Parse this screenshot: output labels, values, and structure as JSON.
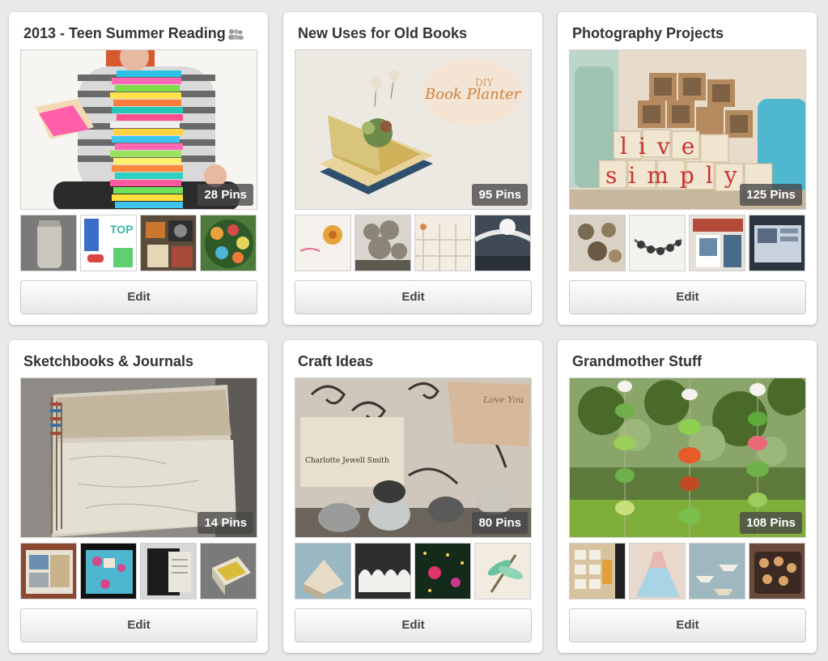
{
  "boards": [
    {
      "title": "2013 - Teen Summer Reading",
      "pin_count": "28 Pins",
      "edit_label": "Edit",
      "collaborators_icon": "group-icon",
      "cover_overlay_text": "",
      "thumbnails": [
        "mason-jar",
        "top-shoes-page",
        "camera-collage",
        "spools-and-beads"
      ]
    },
    {
      "title": "New Uses for Old Books",
      "pin_count": "95 Pins",
      "edit_label": "Edit",
      "cover_overlay_text": "",
      "cover_text_small": "DIY",
      "cover_text_large": "Book Planter",
      "thumbnails": [
        "paper-flower",
        "book-paper-sculpture",
        "book-spine-shelf",
        "paper-garland"
      ]
    },
    {
      "title": "Photography Projects",
      "pin_count": "125 Pins",
      "edit_label": "Edit",
      "cover_text_row1": "live",
      "cover_text_row2": "simply",
      "thumbnails": [
        "photo-pendants",
        "bead-bracelet",
        "photo-prints",
        "photo-page"
      ]
    },
    {
      "title": "Sketchbooks & Journals",
      "pin_count": "14 Pins",
      "edit_label": "Edit",
      "thumbnails": [
        "journal-pages",
        "blue-collage",
        "black-journal",
        "tin-box"
      ]
    },
    {
      "title": "Craft Ideas",
      "pin_count": "80 Pins",
      "edit_label": "Edit",
      "cover_card_text": "Charlotte Jewell Smith",
      "cover_tag_text": "Love You",
      "thumbnails": [
        "folded-book",
        "paper-waves",
        "lights-ornament",
        "dragonfly-craft"
      ]
    },
    {
      "title": "Grandmother Stuff",
      "pin_count": "108 Pins",
      "edit_label": "Edit",
      "thumbnails": [
        "photo-wall",
        "tulle-dress",
        "paper-boats",
        "cookie-tray"
      ]
    }
  ],
  "colors": {
    "page_background": "#e9e9e9",
    "card_background": "#ffffff",
    "title_text": "#333333",
    "badge_background": "#464646"
  }
}
